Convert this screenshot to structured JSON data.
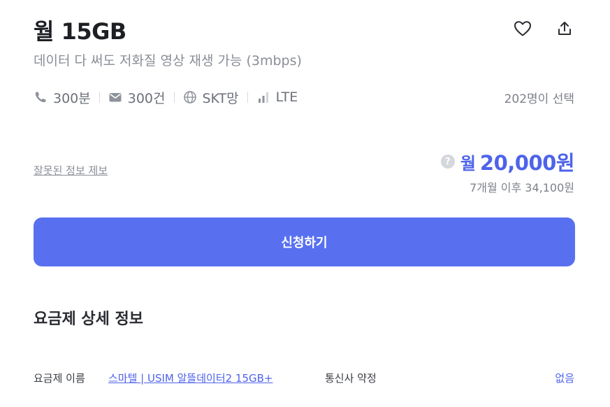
{
  "plan": {
    "title": "월 15GB",
    "subtitle": "데이터 다 써도 저화질 영상 재생 가능 (3mbps)"
  },
  "specs": {
    "call": "300분",
    "sms": "300건",
    "network": "SKT망",
    "type": "LTE",
    "call_icon": "phone-icon",
    "sms_icon": "mail-icon",
    "network_icon": "globe-icon",
    "type_icon": "signal-bars-icon"
  },
  "selected_count": "202명이 선택",
  "report_link": "잘못된 정보 제보",
  "price": {
    "help": "?",
    "prefix": "월",
    "amount": "20,000원",
    "after": "7개월 이후 34,100원"
  },
  "apply_button": "신청하기",
  "details": {
    "section_title": "요금제 상세 정보",
    "name_label": "요금제 이름",
    "name_value": "스마텔 | USIM 알뜰데이터2 15GB+",
    "contract_label": "통신사 약정",
    "contract_value": "없음"
  },
  "colors": {
    "accent": "#5870f0",
    "price": "#4e63ea",
    "muted": "#8a8e96"
  }
}
